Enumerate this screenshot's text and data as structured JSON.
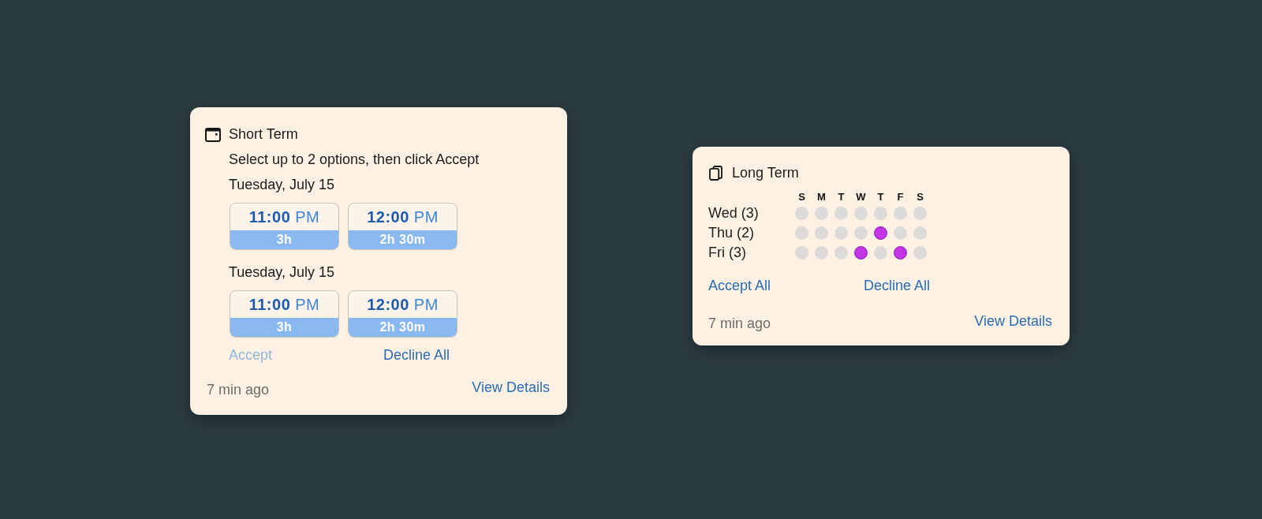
{
  "short_term": {
    "title": "Short Term",
    "instruction": "Select up to 2 options, then click Accept",
    "groups": [
      {
        "date": "Tuesday, July 15",
        "slots": [
          {
            "time": "11:00",
            "period": "PM",
            "duration": "3h",
            "selected": false
          },
          {
            "time": "12:00",
            "period": "PM",
            "duration": "2h 30m",
            "selected": false
          }
        ]
      },
      {
        "date": "Tuesday, July 15",
        "slots": [
          {
            "time": "11:00",
            "period": "PM",
            "duration": "3h",
            "selected": false
          },
          {
            "time": "12:00",
            "period": "PM",
            "duration": "2h 30m",
            "selected": false
          }
        ]
      }
    ],
    "actions": [
      {
        "label": "Accept",
        "disabled": true
      },
      {
        "label": "Decline All",
        "disabled": false
      }
    ],
    "timestamp": "7 min ago",
    "link": "View Details"
  },
  "long_term": {
    "title": "Long Term",
    "weekdays": [
      "S",
      "M",
      "T",
      "W",
      "T",
      "F",
      "S"
    ],
    "rows": [
      {
        "label": "Wed (3)",
        "days": [
          {
            "on": false
          },
          {
            "on": false
          },
          {
            "on": false
          },
          {
            "on": false
          },
          {
            "on": false
          },
          {
            "on": false
          },
          {
            "on": false
          }
        ]
      },
      {
        "label": "Thu (2)",
        "days": [
          {
            "on": false
          },
          {
            "on": false
          },
          {
            "on": false
          },
          {
            "on": false
          },
          {
            "on": true
          },
          {
            "on": false
          },
          {
            "on": false
          }
        ]
      },
      {
        "label": "Fri (3)",
        "days": [
          {
            "on": false
          },
          {
            "on": false
          },
          {
            "on": false
          },
          {
            "on": true
          },
          {
            "on": false
          },
          {
            "on": true
          },
          {
            "on": false
          }
        ]
      }
    ],
    "actions": [
      {
        "label": "Accept All",
        "disabled": false
      },
      {
        "label": "Decline All",
        "disabled": false
      }
    ],
    "timestamp": "7 min ago",
    "link": "View Details"
  }
}
